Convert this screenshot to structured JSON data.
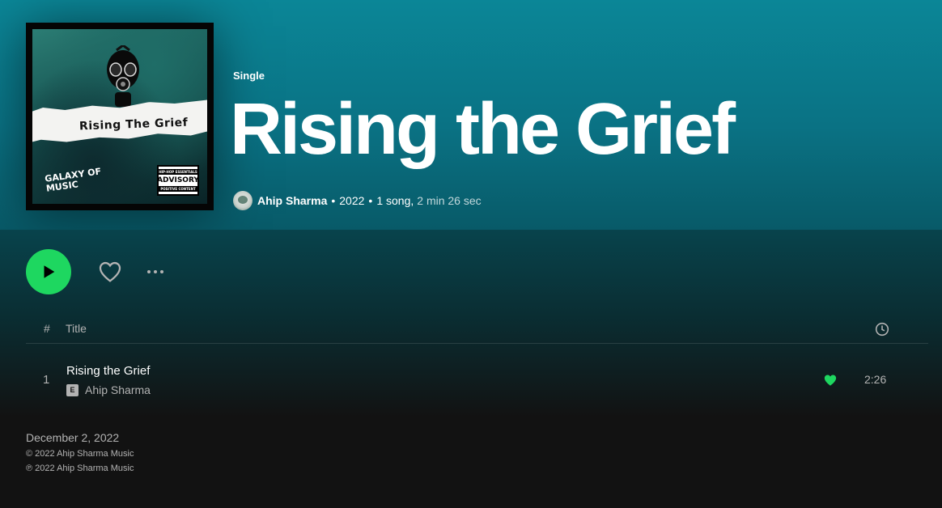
{
  "header": {
    "type_label": "Single",
    "title": "Rising the Grief",
    "artist": "Ahip Sharma",
    "year": "2022",
    "song_count": "1 song,",
    "duration": "2 min 26 sec",
    "separator": "•"
  },
  "cover": {
    "title_text": "Rising The Grief",
    "label_text_line1": "GALAXY OF",
    "label_text_line2": "MUSIC",
    "advisory_top": "HIP-HOP ESSENTIALS",
    "advisory_mid": "ADVISORY",
    "advisory_bottom": "POSITIVE CONTENT"
  },
  "actions": {
    "play_icon": "play-icon",
    "like_icon": "heart-outline-icon",
    "more_icon": "more-options-icon"
  },
  "table": {
    "header_number": "#",
    "header_title": "Title",
    "header_duration_icon": "clock-icon",
    "tracks": [
      {
        "number": "1",
        "title": "Rising the Grief",
        "explicit": "E",
        "artist": "Ahip Sharma",
        "liked": true,
        "duration": "2:26"
      }
    ]
  },
  "footer": {
    "release_date": "December 2, 2022",
    "copyright": "© 2022 Ahip Sharma Music",
    "phonographic": "℗ 2022 Ahip Sharma Music"
  },
  "colors": {
    "accent": "#1ed760",
    "hero_gradient_top": "#0b8697",
    "background": "#121212",
    "muted_text": "#b3b3b3"
  }
}
